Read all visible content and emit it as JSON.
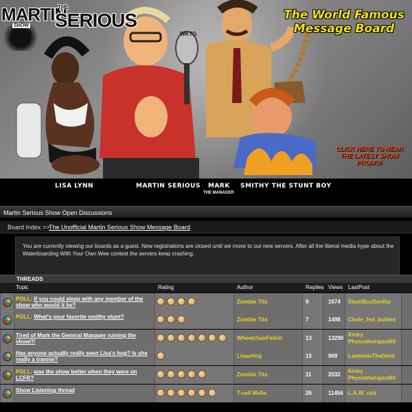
{
  "banner": {
    "logo": {
      "word1": "MARTIN",
      "word2": "THE",
      "word3": "SHOW",
      "word4": "SERIOUS"
    },
    "tagline": "The World Famous Message Board",
    "promo": "CLICK HERE TO HEAR THE LATEST SHOW PROMO!",
    "mic_label": "WKTG",
    "characters": [
      {
        "name": "LISA LYNN"
      },
      {
        "name": "MARTIN SERIOUS"
      },
      {
        "name": "MARK",
        "sub": "THE MANAGER"
      },
      {
        "name": "SMITHY THE STUNT BOY"
      }
    ]
  },
  "board": {
    "title": "Martin Serious Show Open Discussions",
    "breadcrumb_index": "Board Index >>",
    "breadcrumb_link": "The Unofficial Martin Serious Show Message Board",
    "notice": "You are currently viewing our boards as a guest. New registrations are closed until we move to our new servers. After all the liberal media hype about the Waterboarding With Your Own Wee contest the servers keep crashing.",
    "threads_label": "THREADS",
    "columns": {
      "topic": "Topic",
      "rating": "Rating",
      "author": "Author",
      "replies": "Replies",
      "views": "Views",
      "lastpost": "LastPost"
    },
    "threads": [
      {
        "poll": "POLL:",
        "title": "If you could sleep with any member of the show who would it be?",
        "rating": 4,
        "author": "Zombie Tits",
        "replies": "9",
        "views": "1674",
        "lastpost": "StuntBoySmithy"
      },
      {
        "poll": "POLL:",
        "title": "What's your favorite smithy stunt?",
        "rating": 3,
        "author": "Zombie Tits",
        "replies": "7",
        "views": "1498",
        "lastpost": "Chain_fed_bullets"
      },
      {
        "poll": "",
        "title": "Tired of Mark the General Manager ruining the show!!!",
        "rating": 7,
        "author": "WheelchairFetish",
        "replies": "13",
        "views": "13290",
        "lastpost": "Kinky_ Physiotherapist69"
      },
      {
        "poll": "",
        "title": "Has anyone actually really seen Lisa's hog? Is she really a trannie?",
        "rating": 1,
        "author": "LisasHog",
        "replies": "15",
        "views": "969",
        "lastpost": "LawtonIsTheDevil"
      },
      {
        "poll": "POLL:",
        "title": "was the show better when they were on LCFR?",
        "rating": 5,
        "author": "Zombie Tits",
        "replies": "11",
        "views": "2032",
        "lastpost": "Kinky_ Physiotherapist69"
      },
      {
        "poll": "",
        "title": "Show Listening thread",
        "rating": 6,
        "author": "T-cell Mafia",
        "replies": "26",
        "views": "11456",
        "lastpost": "L.A.W_rulz"
      }
    ]
  },
  "colors": {
    "accent_yellow": "#f0d21c",
    "promo_orange": "#e8501c",
    "row_bg": "#707070"
  }
}
